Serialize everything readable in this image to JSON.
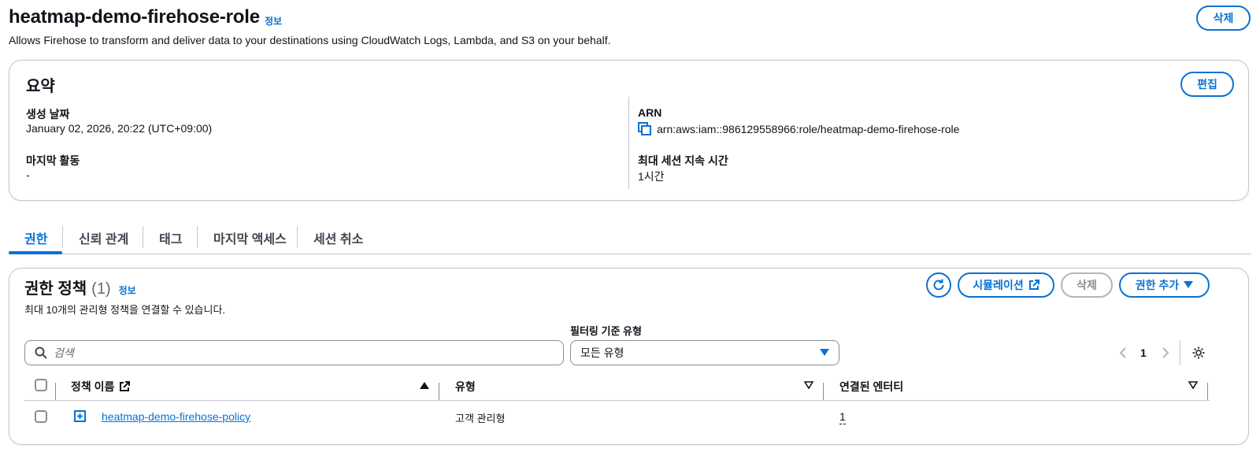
{
  "header": {
    "title": "heatmap-demo-firehose-role",
    "info_label": "정보",
    "description": "Allows Firehose to transform and deliver data to your destinations using CloudWatch Logs, Lambda, and S3 on your behalf.",
    "delete_label": "삭제"
  },
  "summary": {
    "title": "요약",
    "edit_label": "편집",
    "created_key": "생성 날짜",
    "created_value": "January 02, 2026, 20:22 (UTC+09:00)",
    "last_activity_key": "마지막 활동",
    "last_activity_value": "-",
    "arn_key": "ARN",
    "arn_value": "arn:aws:iam::986129558966:role/heatmap-demo-firehose-role",
    "max_session_key": "최대 세션 지속 시간",
    "max_session_value": "1시간"
  },
  "tabs": [
    {
      "label": "권한",
      "active": true
    },
    {
      "label": "신뢰 관계",
      "active": false
    },
    {
      "label": "태그",
      "active": false
    },
    {
      "label": "마지막 액세스",
      "active": false
    },
    {
      "label": "세션 취소",
      "active": false
    }
  ],
  "permissions": {
    "title": "권한 정책",
    "count": "(1)",
    "info_label": "정보",
    "description": "최대 10개의 관리형 정책을 연결할 수 있습니다.",
    "simulation_label": "시뮬레이션",
    "delete_label": "삭제",
    "add_permission_label": "권한 추가",
    "search_placeholder": "검색",
    "filter_label": "필터링 기준 유형",
    "filter_value": "모든 유형",
    "page_number": "1",
    "columns": {
      "policy_name": "정책 이름",
      "type": "유형",
      "attached_entities": "연결된 엔터티"
    },
    "rows": [
      {
        "policy_name": "heatmap-demo-firehose-policy",
        "type": "고객 관리형",
        "attached_entities": "1"
      }
    ]
  },
  "colors": {
    "accent": "#0972d3",
    "text": "#0f141a",
    "border": "#c6c6cd"
  }
}
